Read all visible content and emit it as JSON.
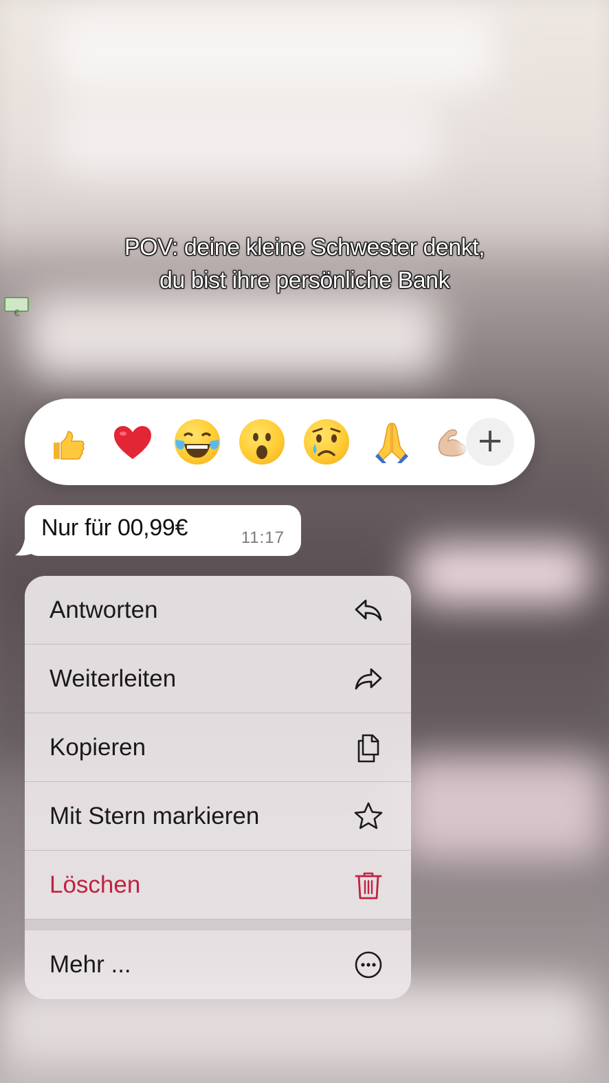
{
  "caption": {
    "line1": "POV: deine kleine Schwester denkt,",
    "line2": "du bist ihre persönliche Bank",
    "line2_icon": "money-with-euro-icon"
  },
  "reactions": [
    {
      "name": "thumbs-up-icon"
    },
    {
      "name": "red-heart-icon"
    },
    {
      "name": "tears-of-joy-icon"
    },
    {
      "name": "surprised-face-icon"
    },
    {
      "name": "crying-face-icon"
    },
    {
      "name": "folded-hands-icon"
    },
    {
      "name": "flexed-biceps-icon"
    }
  ],
  "reaction_more_label": "+",
  "message": {
    "text": "Nur für 00,99€",
    "time": "11:17"
  },
  "menu": {
    "items": [
      {
        "label": "Antworten",
        "icon": "reply-icon"
      },
      {
        "label": "Weiterleiten",
        "icon": "forward-icon"
      },
      {
        "label": "Kopieren",
        "icon": "copy-icon"
      },
      {
        "label": "Mit Stern markieren",
        "icon": "star-icon"
      },
      {
        "label": "Löschen",
        "icon": "trash-icon",
        "color": "#c0223f"
      }
    ],
    "more": {
      "label": "Mehr ...",
      "icon": "more-dots-icon"
    }
  }
}
